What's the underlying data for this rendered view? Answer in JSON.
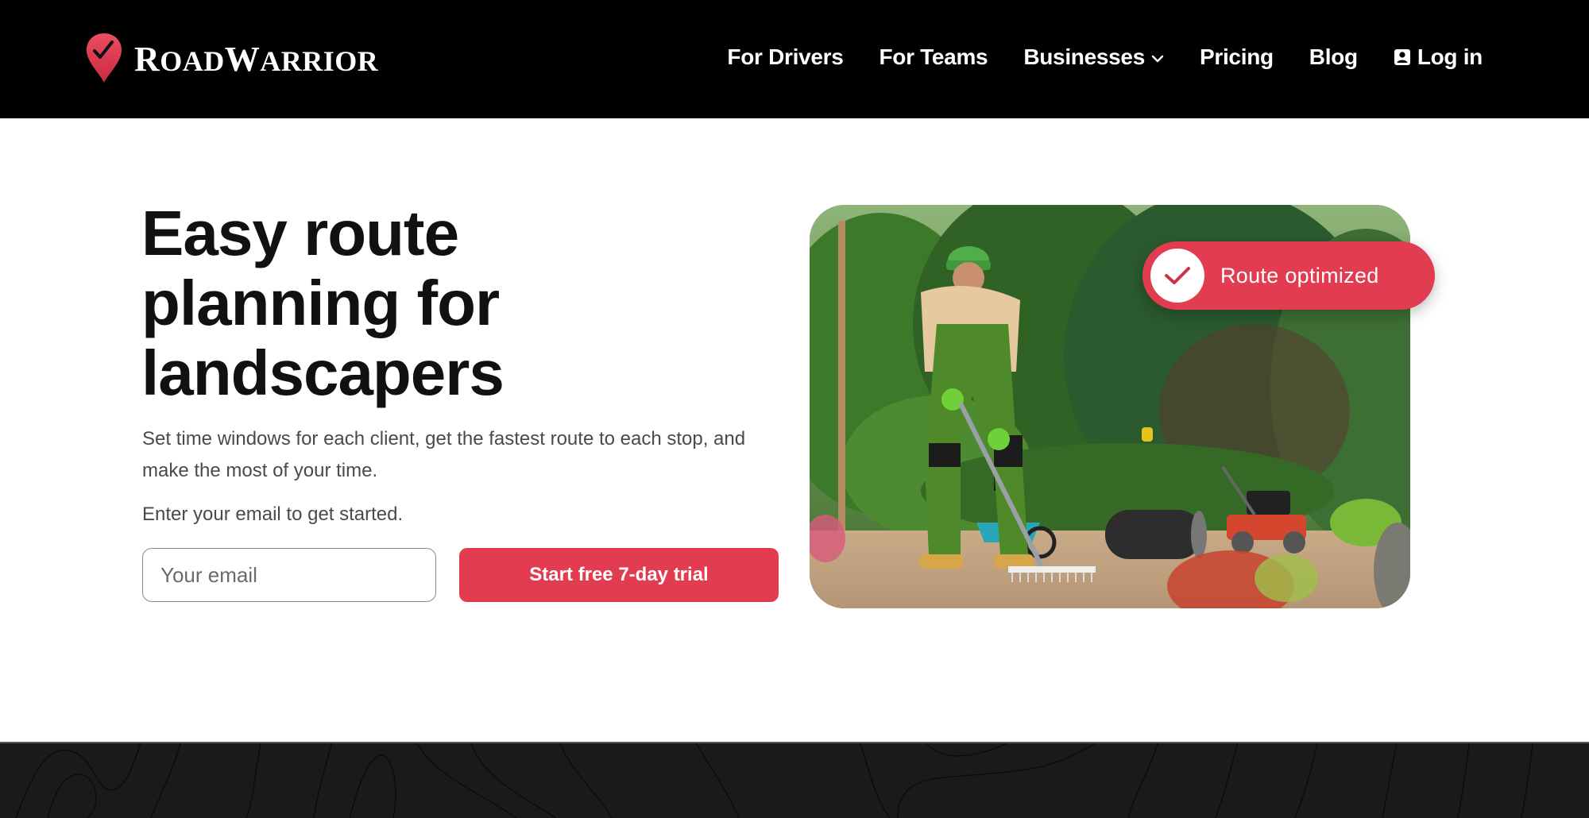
{
  "header": {
    "brand": {
      "name_first": "Road",
      "name_second": "Warrior",
      "icon": "map-pin-check-icon"
    },
    "nav": [
      {
        "label": "For Drivers"
      },
      {
        "label": "For Teams"
      },
      {
        "label": "Businesses",
        "icon": "chevron-down-icon"
      },
      {
        "label": "Pricing"
      },
      {
        "label": "Blog"
      },
      {
        "label": "Log in",
        "icon": "user-account-icon"
      }
    ]
  },
  "hero": {
    "title": "Easy route planning for landscapers",
    "description": "Set time windows for each client, get the fastest route to each stop, and make the most of your time.",
    "prompt": "Enter your email to get started.",
    "email": {
      "value": "",
      "placeholder": "Your email"
    },
    "cta_label": "Start free 7-day trial",
    "image_alt": "Landscaper raking soil in a garden with a lawn roller and mower",
    "badge": {
      "label": "Route optimized",
      "icon": "checkmark-icon"
    }
  },
  "colors": {
    "accent": "#e23c50",
    "header_bg": "#000000",
    "text_dark": "#111111",
    "text_body": "#4a4a4a",
    "footer_bg": "#1a1a1a"
  }
}
